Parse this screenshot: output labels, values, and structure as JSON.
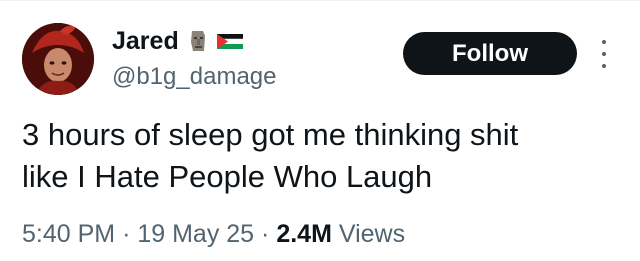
{
  "user": {
    "display_name": "Jared",
    "handle": "@b1g_damage",
    "avatar_icon": "avatar-red-jester-portrait",
    "name_emojis": [
      "moai-icon",
      "palestine-flag-icon"
    ]
  },
  "actions": {
    "follow_label": "Follow",
    "more_icon": "more-vertical-icon"
  },
  "tweet": {
    "lines": [
      "3 hours of sleep got me thinking shit",
      "like I Hate People Who Laugh"
    ]
  },
  "meta": {
    "time": "5:40 PM",
    "separator": "·",
    "date": "19 May 25",
    "views_count": "2.4M",
    "views_label": "Views"
  },
  "colors": {
    "text_primary": "#0f1419",
    "text_secondary": "#536471",
    "follow_bg": "#0f1419",
    "follow_text": "#ffffff"
  }
}
